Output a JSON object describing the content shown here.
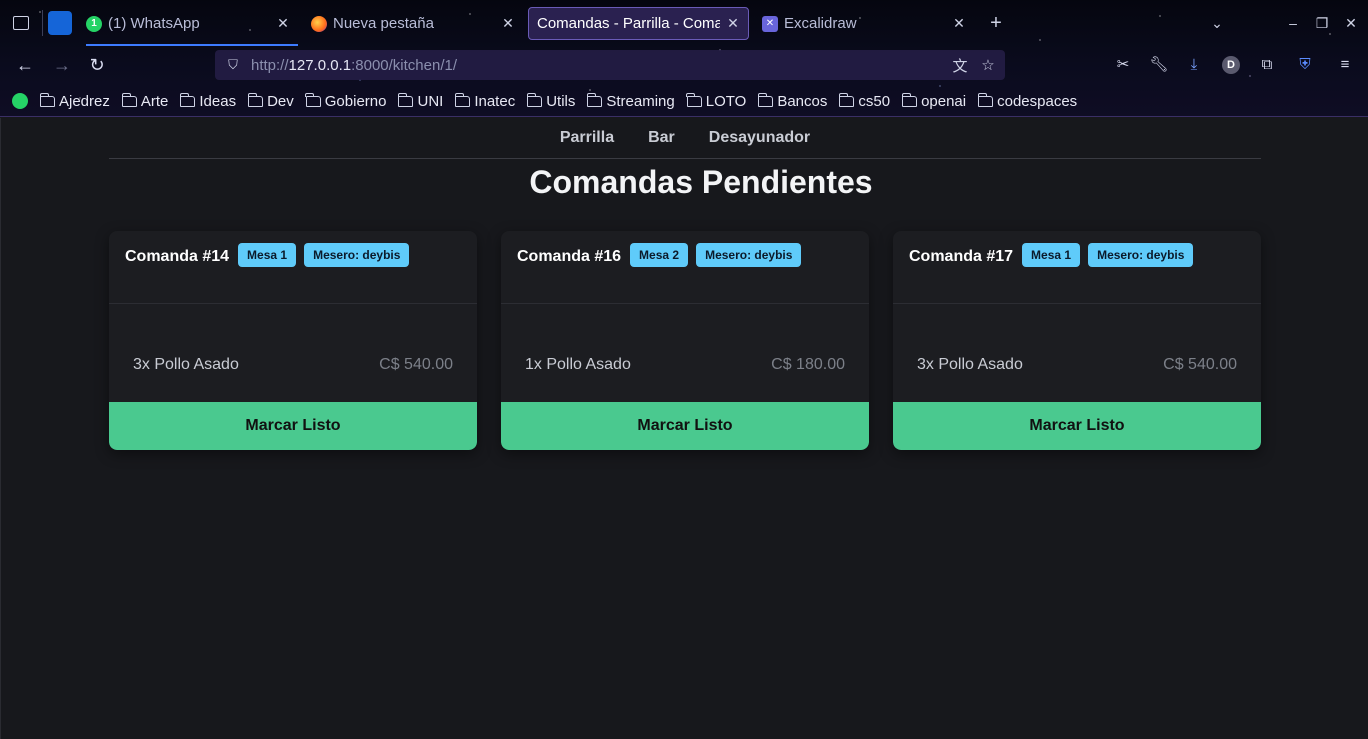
{
  "browser": {
    "tabs": [
      {
        "label": "(1) WhatsApp",
        "badge": "1"
      },
      {
        "label": "Nueva pestaña"
      },
      {
        "label": "Comandas - Parrilla - Comandas"
      },
      {
        "label": "Excalidraw"
      }
    ],
    "url_prefix": "http://",
    "url_host": "127.0.0.1",
    "url_rest": ":8000/kitchen/1/",
    "profile_initial": "D",
    "bookmarks": [
      "Ajedrez",
      "Arte",
      "Ideas",
      "Dev",
      "Gobierno",
      "UNI",
      "Inatec",
      "Utils",
      "Streaming",
      "LOTO",
      "Bancos",
      "cs50",
      "openai",
      "codespaces"
    ]
  },
  "page": {
    "nav": [
      "Parrilla",
      "Bar",
      "Desayunador"
    ],
    "heading": "Comandas Pendientes",
    "orders": [
      {
        "title": "Comanda #14",
        "mesa": "Mesa 1",
        "mesero": "Mesero: deybis",
        "item": "3x Pollo Asado",
        "price": "C$ 540.00",
        "button": "Marcar Listo"
      },
      {
        "title": "Comanda #16",
        "mesa": "Mesa 2",
        "mesero": "Mesero: deybis",
        "item": "1x Pollo Asado",
        "price": "C$ 180.00",
        "button": "Marcar Listo"
      },
      {
        "title": "Comanda #17",
        "mesa": "Mesa 1",
        "mesero": "Mesero: deybis",
        "item": "3x Pollo Asado",
        "price": "C$ 540.00",
        "button": "Marcar Listo"
      }
    ]
  },
  "colors": {
    "accent_button": "#4ac98f",
    "badge": "#5fcbfa",
    "background": "#17181c"
  }
}
